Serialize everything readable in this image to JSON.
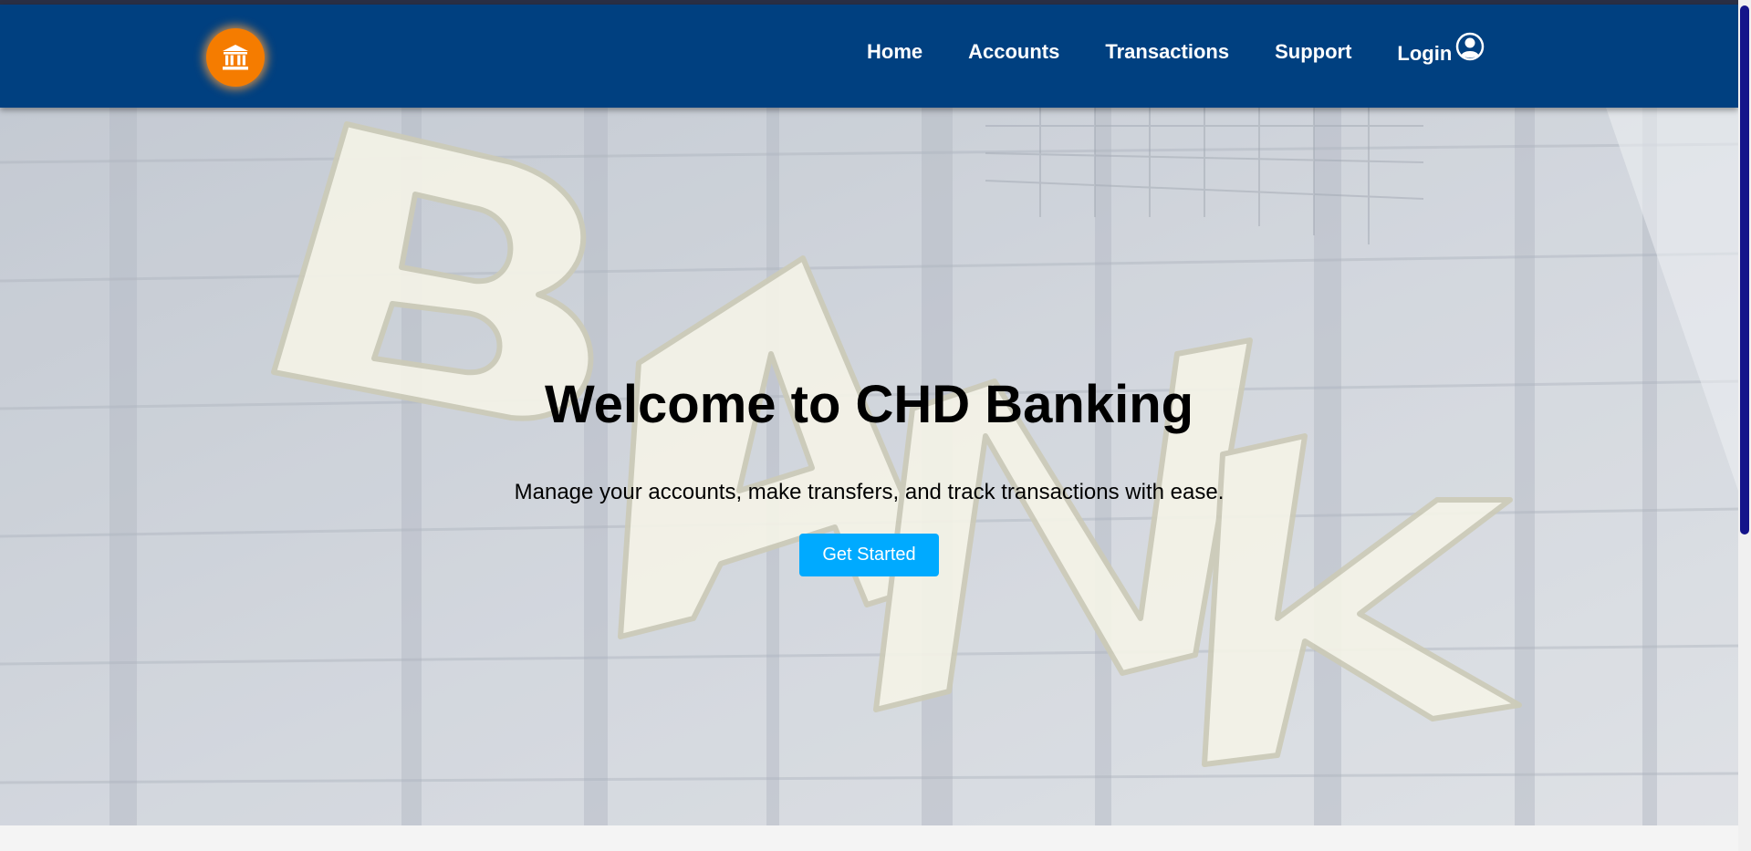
{
  "header": {
    "logo_icon": "bank-icon",
    "logo_color": "#f57c00",
    "background_color": "#004080",
    "nav": [
      {
        "label": "Home"
      },
      {
        "label": "Accounts"
      },
      {
        "label": "Transactions"
      },
      {
        "label": "Support"
      }
    ],
    "login_label": "Login",
    "login_icon": "user-circle-icon"
  },
  "hero": {
    "title": "Welcome to CHD Banking",
    "subtitle": "Manage your accounts, make transfers, and track transactions with ease.",
    "cta_label": "Get Started",
    "cta_color": "#00aaff",
    "background_sign": "BANK"
  }
}
